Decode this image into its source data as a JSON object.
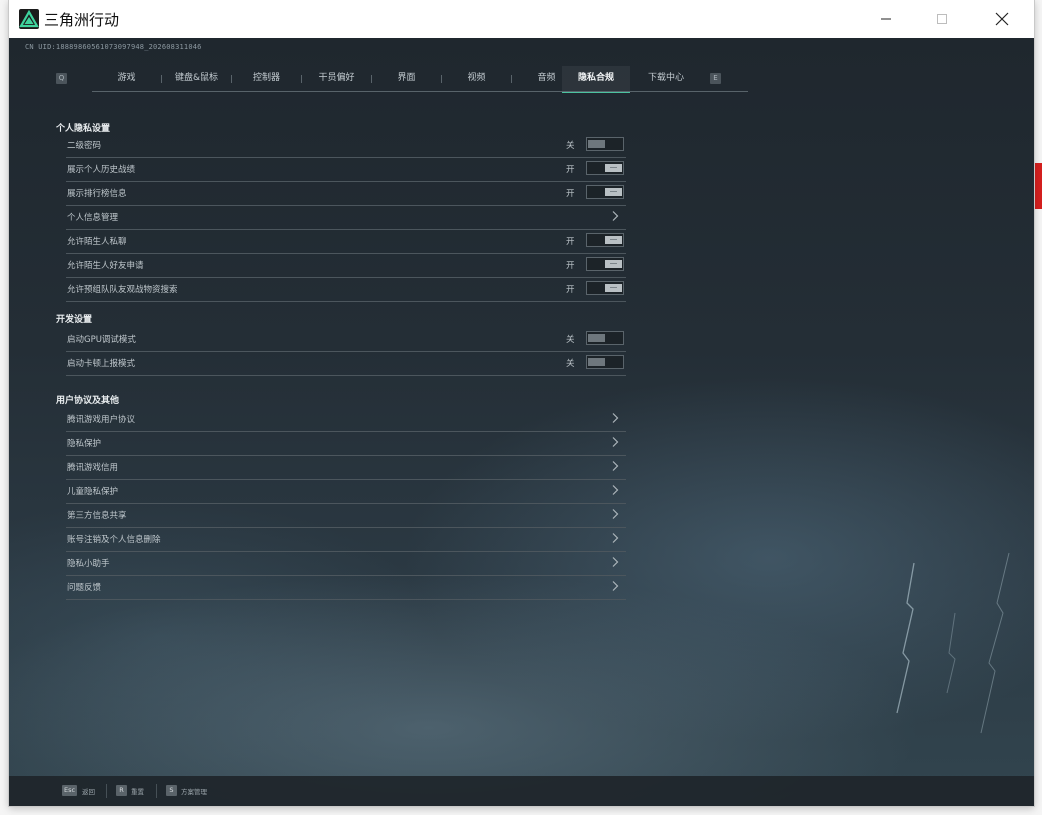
{
  "window": {
    "title": "三角洲行动",
    "minimize_glyph": "—",
    "maximize_glyph": "☐",
    "close_glyph": "✕"
  },
  "uid": "CN UID:18889860561073097948_202608311046",
  "tabs": {
    "prev_key": "Q",
    "next_key": "E",
    "items": [
      {
        "label": "游戏"
      },
      {
        "label": "键盘&鼠标"
      },
      {
        "label": "控制器"
      },
      {
        "label": "干员偏好"
      },
      {
        "label": "界面"
      },
      {
        "label": "视频"
      },
      {
        "label": "音频"
      },
      {
        "label": "隐私合规"
      },
      {
        "label": "下载中心"
      }
    ],
    "active_index": 7
  },
  "sections": [
    {
      "title": "个人隐私设置",
      "rows": [
        {
          "label": "二级密码",
          "state": "关",
          "control": "toggle",
          "on": false
        },
        {
          "label": "展示个人历史战绩",
          "state": "开",
          "control": "toggle",
          "on": true
        },
        {
          "label": "展示排行榜信息",
          "state": "开",
          "control": "toggle",
          "on": true
        },
        {
          "label": "个人信息管理",
          "state": "",
          "control": "link"
        },
        {
          "label": "允许陌生人私聊",
          "state": "开",
          "control": "toggle",
          "on": true
        },
        {
          "label": "允许陌生人好友申请",
          "state": "开",
          "control": "toggle",
          "on": true
        },
        {
          "label": "允许预组队队友观战物资搜索",
          "state": "开",
          "control": "toggle",
          "on": true
        }
      ]
    },
    {
      "title": "开发设置",
      "rows": [
        {
          "label": "启动GPU调试模式",
          "state": "关",
          "control": "toggle",
          "on": false
        },
        {
          "label": "启动卡顿上报模式",
          "state": "关",
          "control": "toggle",
          "on": false
        }
      ]
    },
    {
      "title": "用户协议及其他",
      "rows": [
        {
          "label": "腾讯游戏用户协议",
          "state": "",
          "control": "link"
        },
        {
          "label": "隐私保护",
          "state": "",
          "control": "link"
        },
        {
          "label": "腾讯游戏信用",
          "state": "",
          "control": "link"
        },
        {
          "label": "儿童隐私保护",
          "state": "",
          "control": "link"
        },
        {
          "label": "第三方信息共享",
          "state": "",
          "control": "link"
        },
        {
          "label": "账号注销及个人信息删除",
          "state": "",
          "control": "link"
        },
        {
          "label": "隐私小助手",
          "state": "",
          "control": "link"
        },
        {
          "label": "问题反馈",
          "state": "",
          "control": "link"
        }
      ]
    }
  ],
  "bottom_bar": [
    {
      "key": "Esc",
      "label": "返回"
    },
    {
      "key": "R",
      "label": "重置"
    },
    {
      "key": "S",
      "label": "方案管理"
    }
  ],
  "colors": {
    "accent": "#4cc3a0",
    "panel_bg": "#242e36",
    "text": "#bfc7cc"
  }
}
